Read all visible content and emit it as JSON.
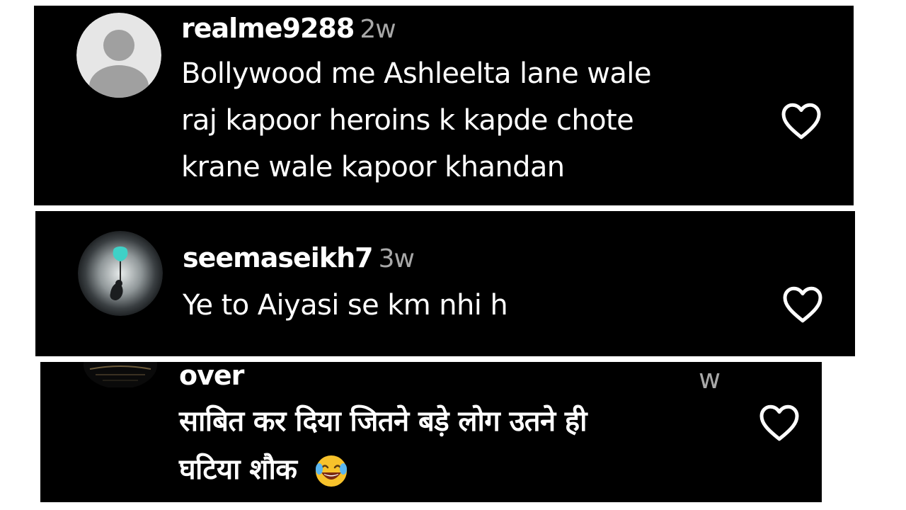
{
  "comments": [
    {
      "username": "realme9288",
      "time": "2w",
      "text_lines": [
        "Bollywood me Ashleelta lane wale",
        "raj kapoor heroins k kapde chote",
        "krane wale kapoor khandan"
      ]
    },
    {
      "username": "seemaseikh7",
      "time": "3w",
      "text_lines": [
        "Ye to Aiyasi se km nhi h"
      ]
    },
    {
      "username": "over",
      "time": "w",
      "text_lines": [
        "साबित कर दिया जितने बड़े लोग उतने ही",
        "घटिया शौक"
      ],
      "emoji": "laughing-tears-emoji"
    }
  ],
  "icons": {
    "like": "heart-outline-icon",
    "default_avatar": "default-avatar-icon"
  },
  "colors": {
    "card_background": "#000000",
    "text": "#ffffff",
    "timestamp": "#a8a8a8",
    "default_avatar_bg": "#e6e6e6",
    "default_avatar_fg": "#a0a0a0"
  }
}
